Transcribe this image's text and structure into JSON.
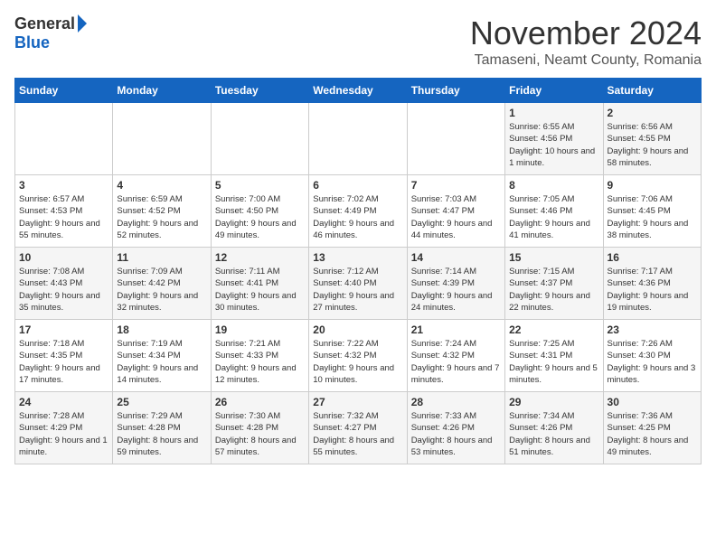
{
  "logo": {
    "general": "General",
    "blue": "Blue"
  },
  "title": "November 2024",
  "location": "Tamaseni, Neamt County, Romania",
  "days_of_week": [
    "Sunday",
    "Monday",
    "Tuesday",
    "Wednesday",
    "Thursday",
    "Friday",
    "Saturday"
  ],
  "weeks": [
    [
      {
        "day": "",
        "sunrise": "",
        "sunset": "",
        "daylight": ""
      },
      {
        "day": "",
        "sunrise": "",
        "sunset": "",
        "daylight": ""
      },
      {
        "day": "",
        "sunrise": "",
        "sunset": "",
        "daylight": ""
      },
      {
        "day": "",
        "sunrise": "",
        "sunset": "",
        "daylight": ""
      },
      {
        "day": "",
        "sunrise": "",
        "sunset": "",
        "daylight": ""
      },
      {
        "day": "1",
        "sunrise": "Sunrise: 6:55 AM",
        "sunset": "Sunset: 4:56 PM",
        "daylight": "Daylight: 10 hours and 1 minute."
      },
      {
        "day": "2",
        "sunrise": "Sunrise: 6:56 AM",
        "sunset": "Sunset: 4:55 PM",
        "daylight": "Daylight: 9 hours and 58 minutes."
      }
    ],
    [
      {
        "day": "3",
        "sunrise": "Sunrise: 6:57 AM",
        "sunset": "Sunset: 4:53 PM",
        "daylight": "Daylight: 9 hours and 55 minutes."
      },
      {
        "day": "4",
        "sunrise": "Sunrise: 6:59 AM",
        "sunset": "Sunset: 4:52 PM",
        "daylight": "Daylight: 9 hours and 52 minutes."
      },
      {
        "day": "5",
        "sunrise": "Sunrise: 7:00 AM",
        "sunset": "Sunset: 4:50 PM",
        "daylight": "Daylight: 9 hours and 49 minutes."
      },
      {
        "day": "6",
        "sunrise": "Sunrise: 7:02 AM",
        "sunset": "Sunset: 4:49 PM",
        "daylight": "Daylight: 9 hours and 46 minutes."
      },
      {
        "day": "7",
        "sunrise": "Sunrise: 7:03 AM",
        "sunset": "Sunset: 4:47 PM",
        "daylight": "Daylight: 9 hours and 44 minutes."
      },
      {
        "day": "8",
        "sunrise": "Sunrise: 7:05 AM",
        "sunset": "Sunset: 4:46 PM",
        "daylight": "Daylight: 9 hours and 41 minutes."
      },
      {
        "day": "9",
        "sunrise": "Sunrise: 7:06 AM",
        "sunset": "Sunset: 4:45 PM",
        "daylight": "Daylight: 9 hours and 38 minutes."
      }
    ],
    [
      {
        "day": "10",
        "sunrise": "Sunrise: 7:08 AM",
        "sunset": "Sunset: 4:43 PM",
        "daylight": "Daylight: 9 hours and 35 minutes."
      },
      {
        "day": "11",
        "sunrise": "Sunrise: 7:09 AM",
        "sunset": "Sunset: 4:42 PM",
        "daylight": "Daylight: 9 hours and 32 minutes."
      },
      {
        "day": "12",
        "sunrise": "Sunrise: 7:11 AM",
        "sunset": "Sunset: 4:41 PM",
        "daylight": "Daylight: 9 hours and 30 minutes."
      },
      {
        "day": "13",
        "sunrise": "Sunrise: 7:12 AM",
        "sunset": "Sunset: 4:40 PM",
        "daylight": "Daylight: 9 hours and 27 minutes."
      },
      {
        "day": "14",
        "sunrise": "Sunrise: 7:14 AM",
        "sunset": "Sunset: 4:39 PM",
        "daylight": "Daylight: 9 hours and 24 minutes."
      },
      {
        "day": "15",
        "sunrise": "Sunrise: 7:15 AM",
        "sunset": "Sunset: 4:37 PM",
        "daylight": "Daylight: 9 hours and 22 minutes."
      },
      {
        "day": "16",
        "sunrise": "Sunrise: 7:17 AM",
        "sunset": "Sunset: 4:36 PM",
        "daylight": "Daylight: 9 hours and 19 minutes."
      }
    ],
    [
      {
        "day": "17",
        "sunrise": "Sunrise: 7:18 AM",
        "sunset": "Sunset: 4:35 PM",
        "daylight": "Daylight: 9 hours and 17 minutes."
      },
      {
        "day": "18",
        "sunrise": "Sunrise: 7:19 AM",
        "sunset": "Sunset: 4:34 PM",
        "daylight": "Daylight: 9 hours and 14 minutes."
      },
      {
        "day": "19",
        "sunrise": "Sunrise: 7:21 AM",
        "sunset": "Sunset: 4:33 PM",
        "daylight": "Daylight: 9 hours and 12 minutes."
      },
      {
        "day": "20",
        "sunrise": "Sunrise: 7:22 AM",
        "sunset": "Sunset: 4:32 PM",
        "daylight": "Daylight: 9 hours and 10 minutes."
      },
      {
        "day": "21",
        "sunrise": "Sunrise: 7:24 AM",
        "sunset": "Sunset: 4:32 PM",
        "daylight": "Daylight: 9 hours and 7 minutes."
      },
      {
        "day": "22",
        "sunrise": "Sunrise: 7:25 AM",
        "sunset": "Sunset: 4:31 PM",
        "daylight": "Daylight: 9 hours and 5 minutes."
      },
      {
        "day": "23",
        "sunrise": "Sunrise: 7:26 AM",
        "sunset": "Sunset: 4:30 PM",
        "daylight": "Daylight: 9 hours and 3 minutes."
      }
    ],
    [
      {
        "day": "24",
        "sunrise": "Sunrise: 7:28 AM",
        "sunset": "Sunset: 4:29 PM",
        "daylight": "Daylight: 9 hours and 1 minute."
      },
      {
        "day": "25",
        "sunrise": "Sunrise: 7:29 AM",
        "sunset": "Sunset: 4:28 PM",
        "daylight": "Daylight: 8 hours and 59 minutes."
      },
      {
        "day": "26",
        "sunrise": "Sunrise: 7:30 AM",
        "sunset": "Sunset: 4:28 PM",
        "daylight": "Daylight: 8 hours and 57 minutes."
      },
      {
        "day": "27",
        "sunrise": "Sunrise: 7:32 AM",
        "sunset": "Sunset: 4:27 PM",
        "daylight": "Daylight: 8 hours and 55 minutes."
      },
      {
        "day": "28",
        "sunrise": "Sunrise: 7:33 AM",
        "sunset": "Sunset: 4:26 PM",
        "daylight": "Daylight: 8 hours and 53 minutes."
      },
      {
        "day": "29",
        "sunrise": "Sunrise: 7:34 AM",
        "sunset": "Sunset: 4:26 PM",
        "daylight": "Daylight: 8 hours and 51 minutes."
      },
      {
        "day": "30",
        "sunrise": "Sunrise: 7:36 AM",
        "sunset": "Sunset: 4:25 PM",
        "daylight": "Daylight: 8 hours and 49 minutes."
      }
    ]
  ]
}
